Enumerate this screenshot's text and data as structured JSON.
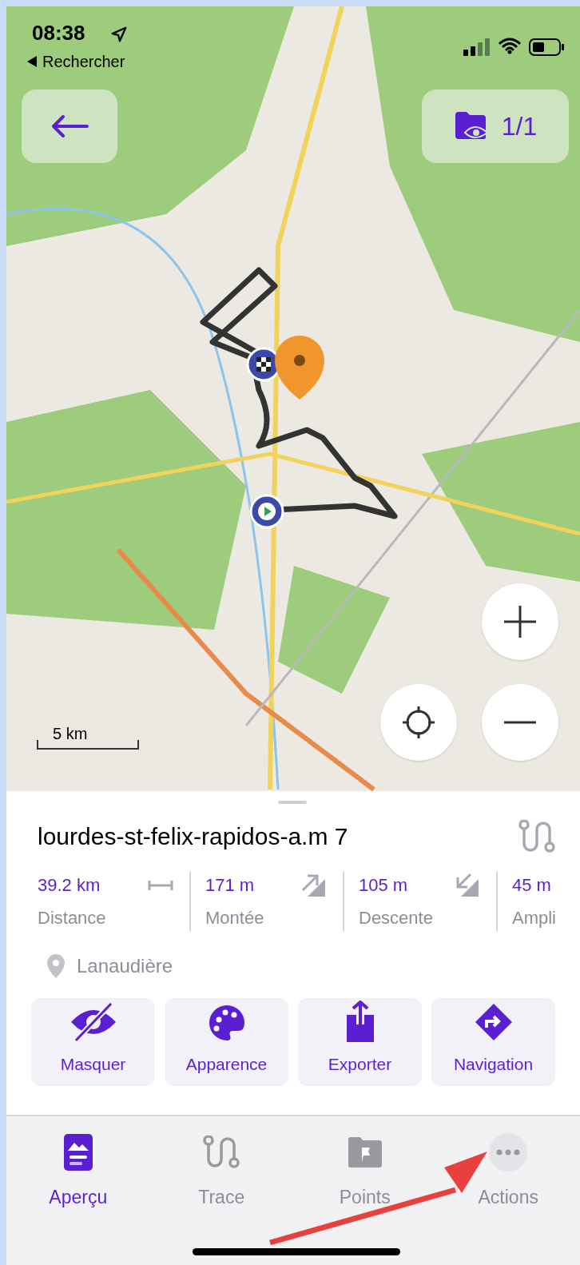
{
  "status_bar": {
    "time": "08:38",
    "back_app": "Rechercher"
  },
  "map": {
    "layers_count": "1/1",
    "scale": "5 km"
  },
  "track": {
    "title": "lourdes-st-felix-rapidos-a.m 7",
    "stats": [
      {
        "kind": "distance",
        "value": "39.2 km",
        "label": "Distance"
      },
      {
        "kind": "ascent",
        "value": "171 m",
        "label": "Montée"
      },
      {
        "kind": "descent",
        "value": "105 m",
        "label": "Descente"
      },
      {
        "kind": "range",
        "value": "45 m",
        "label": "Ampli"
      }
    ],
    "location": "Lanaudière",
    "actions": [
      {
        "kind": "hide",
        "label": "Masquer"
      },
      {
        "kind": "appearance",
        "label": "Apparence"
      },
      {
        "kind": "export",
        "label": "Exporter"
      },
      {
        "kind": "navigation",
        "label": "Navigation"
      }
    ]
  },
  "tabs": [
    {
      "kind": "overview",
      "label": "Aperçu",
      "selected": true
    },
    {
      "kind": "trace",
      "label": "Trace",
      "selected": false
    },
    {
      "kind": "points",
      "label": "Points",
      "selected": false
    },
    {
      "kind": "actions",
      "label": "Actions",
      "selected": false
    }
  ]
}
